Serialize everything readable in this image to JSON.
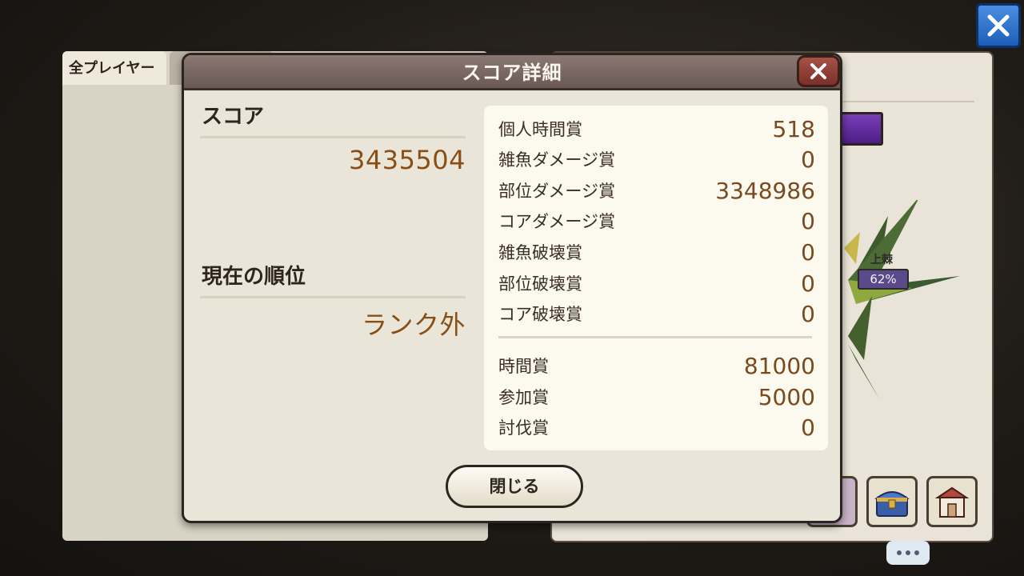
{
  "background": {
    "tab_all_players": "全プレイヤー",
    "boss_name": "上棘",
    "boss_percent": "62%"
  },
  "dialog": {
    "title": "スコア詳細",
    "score_label": "スコア",
    "score_value": "3435504",
    "rank_label": "現在の順位",
    "rank_value": "ランク外",
    "details": [
      {
        "label": "個人時間賞",
        "value": "518"
      },
      {
        "label": "雑魚ダメージ賞",
        "value": "0"
      },
      {
        "label": "部位ダメージ賞",
        "value": "3348986"
      },
      {
        "label": "コアダメージ賞",
        "value": "0"
      },
      {
        "label": "雑魚破壊賞",
        "value": "0"
      },
      {
        "label": "部位破壊賞",
        "value": "0"
      },
      {
        "label": "コア破壊賞",
        "value": "0"
      }
    ],
    "bonuses": [
      {
        "label": "時間賞",
        "value": "81000"
      },
      {
        "label": "参加賞",
        "value": "5000"
      },
      {
        "label": "討伐賞",
        "value": "0"
      }
    ],
    "close_button": "閉じる"
  },
  "icons": {
    "top_close": "close-icon",
    "dialog_close": "close-icon",
    "chest": "treasure-chest-icon",
    "shop": "shop-icon",
    "chat": "chat-bubble-icon"
  },
  "colors": {
    "value_brown": "#8a4e14",
    "header": "#7a6863",
    "close_red": "#8c3a30",
    "top_close_blue": "#2f74cc"
  }
}
